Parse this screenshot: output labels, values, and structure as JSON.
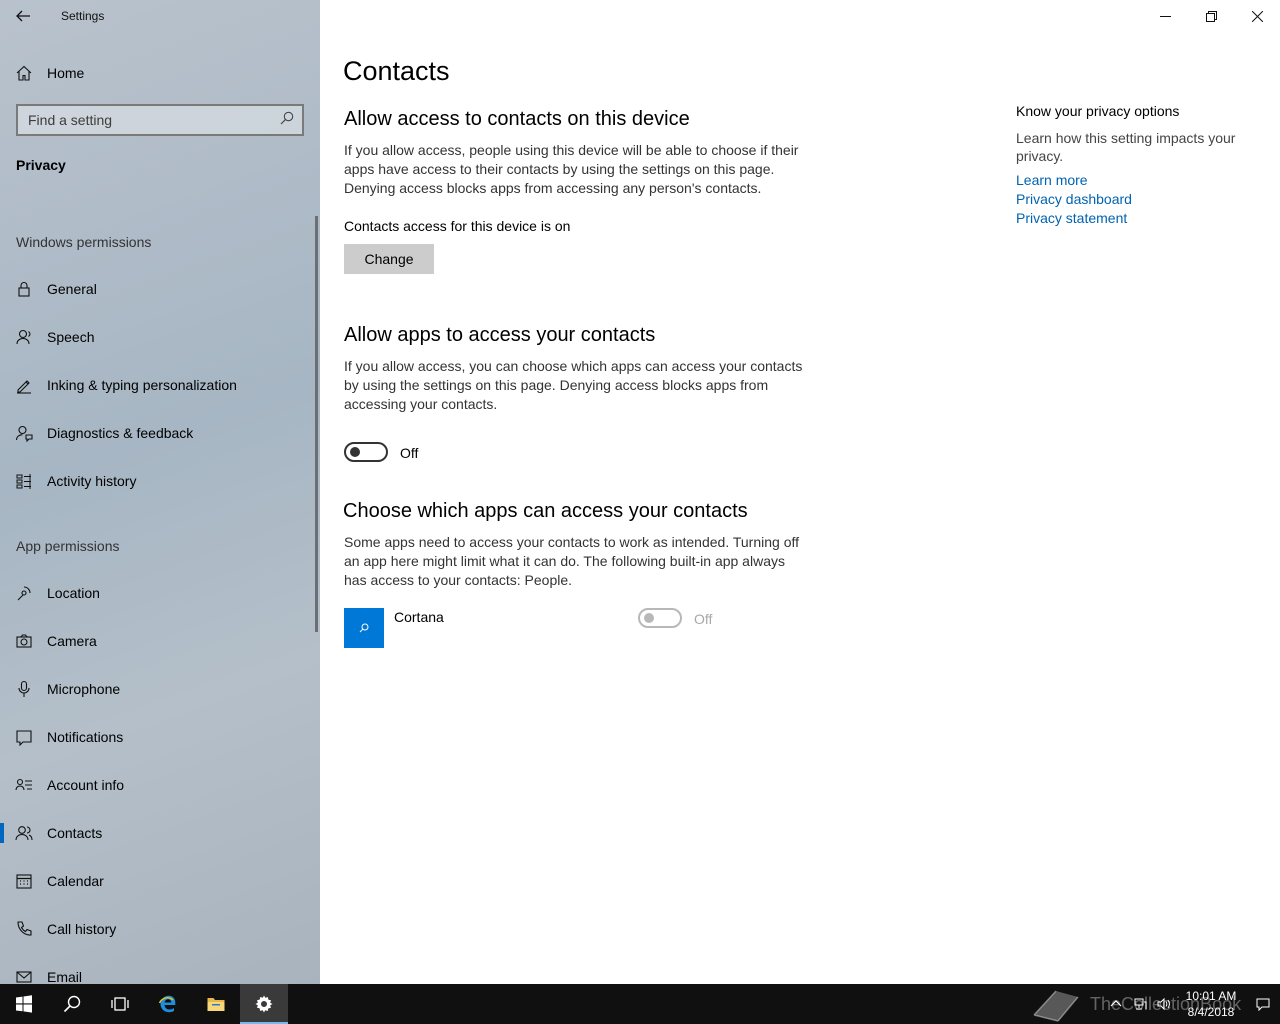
{
  "window": {
    "title": "Settings",
    "minimize_icon": "minimize-icon",
    "maximize_icon": "restore-icon",
    "close_icon": "close-icon"
  },
  "sidebar": {
    "home_label": "Home",
    "search_placeholder": "Find a setting",
    "section_title": "Privacy",
    "windows_permissions_header": "Windows permissions",
    "windows_permissions": [
      {
        "label": "General",
        "icon": "lock-icon"
      },
      {
        "label": "Speech",
        "icon": "speech-icon"
      },
      {
        "label": "Inking & typing personalization",
        "icon": "inking-icon"
      },
      {
        "label": "Diagnostics & feedback",
        "icon": "diagnostics-icon"
      },
      {
        "label": "Activity history",
        "icon": "activity-icon"
      }
    ],
    "app_permissions_header": "App permissions",
    "app_permissions": [
      {
        "label": "Location",
        "icon": "location-icon"
      },
      {
        "label": "Camera",
        "icon": "camera-icon"
      },
      {
        "label": "Microphone",
        "icon": "microphone-icon"
      },
      {
        "label": "Notifications",
        "icon": "notifications-icon"
      },
      {
        "label": "Account info",
        "icon": "account-info-icon"
      },
      {
        "label": "Contacts",
        "icon": "contacts-icon",
        "selected": true
      },
      {
        "label": "Calendar",
        "icon": "calendar-icon"
      },
      {
        "label": "Call history",
        "icon": "call-history-icon"
      },
      {
        "label": "Email",
        "icon": "email-icon"
      }
    ]
  },
  "main": {
    "page_title": "Contacts",
    "device_section": {
      "heading": "Allow access to contacts on this device",
      "description": "If you allow access, people using this device will be able to choose if their apps have access to their contacts by using the settings on this page. Denying access blocks apps from accessing any person's contacts.",
      "status": "Contacts access for this device is on",
      "button_label": "Change"
    },
    "apps_section": {
      "heading": "Allow apps to access your contacts",
      "description": "If you allow access, you can choose which apps can access your contacts by using the settings on this page. Denying access blocks apps from accessing your contacts.",
      "toggle_state": "Off"
    },
    "choose_section": {
      "heading": "Choose which apps can access your contacts",
      "description": "Some apps need to access your contacts to work as intended. Turning off an app here might limit what it can do. The following built-in app always has access to your contacts: People.",
      "apps": [
        {
          "name": "Cortana",
          "toggle_state": "Off",
          "tile_color": "#0078d7"
        }
      ]
    },
    "side_panel": {
      "title": "Know your privacy options",
      "description": "Learn how this setting impacts your privacy.",
      "links": [
        "Learn more",
        "Privacy dashboard",
        "Privacy statement"
      ]
    }
  },
  "taskbar": {
    "items": [
      "start-icon",
      "search-icon",
      "task-view-icon",
      "edge-icon",
      "file-explorer-icon",
      "settings-icon"
    ],
    "active": "settings-icon",
    "clock_time": "10:01 AM",
    "clock_date": "8/4/2018",
    "watermark": "TheCollectionBook"
  },
  "colors": {
    "accent": "#0078d7",
    "link": "#0063b1",
    "taskbar": "#101010"
  }
}
